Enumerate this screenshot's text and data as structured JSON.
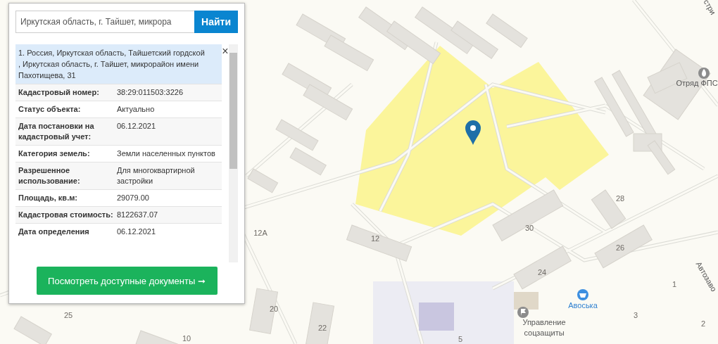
{
  "search": {
    "value": "Иркутская область, г. Тайшет, микрора",
    "button": "Найти"
  },
  "result": {
    "title": "1. Россия, Иркутская область, Тайшетский гордской , Иркутская область, г. Тайшет, микрорайон имени Пахотищева, 31",
    "close": "×"
  },
  "fields": [
    {
      "label": "Кадастровый номер:",
      "value": "38:29:011503:3226"
    },
    {
      "label": "Статус объекта:",
      "value": "Актуально"
    },
    {
      "label": "Дата постановки на кадастровый учет:",
      "value": "06.12.2021"
    },
    {
      "label": "Категория земель:",
      "value": "Земли населенных пунктов"
    },
    {
      "label": "Разрешенное использование:",
      "value": "Для многоквартирной застройки"
    },
    {
      "label": "Площадь, кв.м:",
      "value": "29079.00"
    },
    {
      "label": "Кадастровая стоимость:",
      "value": "8122637.07"
    },
    {
      "label": "Дата определения",
      "value": "06.12.2021"
    }
  ],
  "documents_button": "Посмотреть доступные документы ➞",
  "map": {
    "labels": [
      {
        "text": "12А",
        "kind": "house"
      },
      {
        "text": "12",
        "kind": "house"
      },
      {
        "text": "30",
        "kind": "house"
      },
      {
        "text": "28",
        "kind": "house"
      },
      {
        "text": "26",
        "kind": "house"
      },
      {
        "text": "24",
        "kind": "house"
      },
      {
        "text": "20",
        "kind": "house"
      },
      {
        "text": "22",
        "kind": "house"
      },
      {
        "text": "25",
        "kind": "house"
      },
      {
        "text": "10",
        "kind": "house"
      },
      {
        "text": "5",
        "kind": "house"
      },
      {
        "text": "1",
        "kind": "house"
      },
      {
        "text": "3",
        "kind": "house"
      },
      {
        "text": "2",
        "kind": "house"
      },
      {
        "text": "Авоська",
        "kind": "shop"
      },
      {
        "text": "Управление",
        "kind": "poi"
      },
      {
        "text": "соцзащиты",
        "kind": "poi"
      },
      {
        "text": "Отряд ФПС",
        "kind": "poi"
      },
      {
        "text": "Автозаво",
        "kind": "street"
      },
      {
        "text": "стри",
        "kind": "street"
      }
    ]
  }
}
